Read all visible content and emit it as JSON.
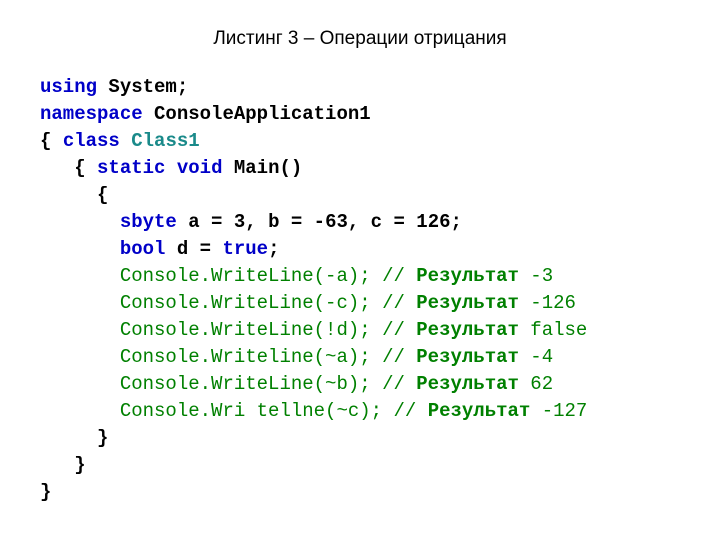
{
  "title": "Листинг 3 – Операции отрицания",
  "t": {
    "using": "using",
    "System": "System",
    "sc": ";",
    "namespace": "namespace",
    "ConsoleApplication1": "ConsoleApplication1",
    "lb": "{",
    "rb": "}",
    "class": "class",
    "Class1": "Class1",
    "static": "static",
    "void": "void",
    "Main": "Main()",
    "sbyte": "sbyte",
    "decl1": "а = 3, b = -63, с = 126;",
    "bool": "bool",
    "decl2": "d = ",
    "true": "true",
    "l1a": "Console.WriteLine(-a); // ",
    "l1b": "Результат",
    "l1c": " -3",
    "l2a": "Console.WriteLine(-c); // ",
    "l2c": " -126",
    "l3a": "Console.WriteLine(!d); // ",
    "l3c": " false",
    "l4a": "Console.Writeline(~a); // ",
    "l4c": " -4",
    "l5a": "Console.WriteLine(~b); // ",
    "l5c": " 62",
    "l6a": "Console.Wri tellne(~c); // ",
    "l6c": " -127"
  }
}
